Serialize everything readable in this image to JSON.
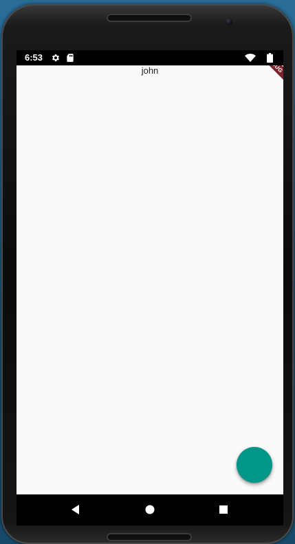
{
  "status_bar": {
    "time": "6:53",
    "icons": [
      "settings-icon",
      "sd-card-icon",
      "wifi-icon",
      "battery-icon"
    ]
  },
  "debug_banner": {
    "label": "DEBUG",
    "color": "#7e2230"
  },
  "app": {
    "text": "john",
    "background": "#fafafa"
  },
  "fab": {
    "color": "#009688"
  },
  "nav_bar": {
    "buttons": [
      "back-icon",
      "home-icon",
      "recents-icon"
    ]
  }
}
